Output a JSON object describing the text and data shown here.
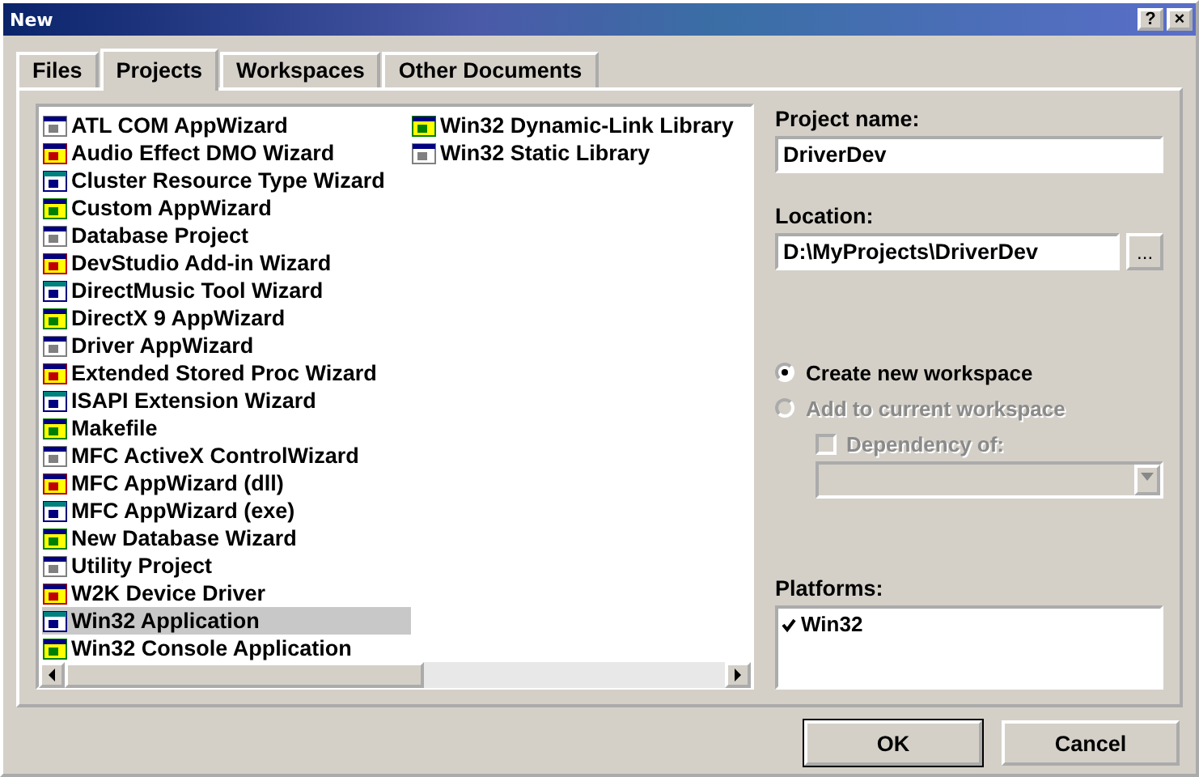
{
  "window": {
    "title": "New",
    "buttons": [
      "?",
      "×"
    ]
  },
  "tabs": [
    {
      "label": "Files",
      "selected": false
    },
    {
      "label": "Projects",
      "selected": true
    },
    {
      "label": "Workspaces",
      "selected": false
    },
    {
      "label": "Other Documents",
      "selected": false
    }
  ],
  "project_columns": [
    {
      "items": [
        {
          "label": "ATL COM AppWizard",
          "selected": false
        },
        {
          "label": "Audio Effect DMO Wizard",
          "selected": false
        },
        {
          "label": "Cluster Resource Type Wizard",
          "selected": false
        },
        {
          "label": "Custom AppWizard",
          "selected": false
        },
        {
          "label": "Database Project",
          "selected": false
        },
        {
          "label": "DevStudio Add-in Wizard",
          "selected": false
        },
        {
          "label": "DirectMusic Tool Wizard",
          "selected": false
        },
        {
          "label": "DirectX 9 AppWizard",
          "selected": false
        },
        {
          "label": "Driver AppWizard",
          "selected": false
        },
        {
          "label": "Extended Stored Proc Wizard",
          "selected": false
        },
        {
          "label": "ISAPI Extension Wizard",
          "selected": false
        },
        {
          "label": "Makefile",
          "selected": false
        },
        {
          "label": "MFC ActiveX ControlWizard",
          "selected": false
        },
        {
          "label": "MFC AppWizard (dll)",
          "selected": false
        },
        {
          "label": "MFC AppWizard (exe)",
          "selected": false
        },
        {
          "label": "New Database Wizard",
          "selected": false
        },
        {
          "label": "Utility Project",
          "selected": false
        },
        {
          "label": "W2K Device Driver",
          "selected": false
        },
        {
          "label": "Win32 Application",
          "selected": true
        },
        {
          "label": "Win32 Console Application",
          "selected": false
        }
      ]
    },
    {
      "items": [
        {
          "label": "Win32 Dynamic-Link Library",
          "selected": false
        },
        {
          "label": "Win32 Static Library",
          "selected": false
        }
      ]
    }
  ],
  "project_name": {
    "label": "Project name:",
    "value": "DriverDev"
  },
  "location": {
    "label": "Location:",
    "value": "D:\\MyProjects\\DriverDev",
    "browse": "..."
  },
  "workspace_options": [
    {
      "label": "Create new workspace",
      "selected": true,
      "disabled": false
    },
    {
      "label": "Add to current workspace",
      "selected": false,
      "disabled": true
    }
  ],
  "dependency": {
    "label": "Dependency of:",
    "checked": false,
    "disabled": true
  },
  "platforms": {
    "label": "Platforms:",
    "items": [
      {
        "label": "Win32",
        "checked": true
      }
    ]
  },
  "buttons": [
    {
      "label": "OK",
      "default": true
    },
    {
      "label": "Cancel",
      "default": false
    }
  ]
}
